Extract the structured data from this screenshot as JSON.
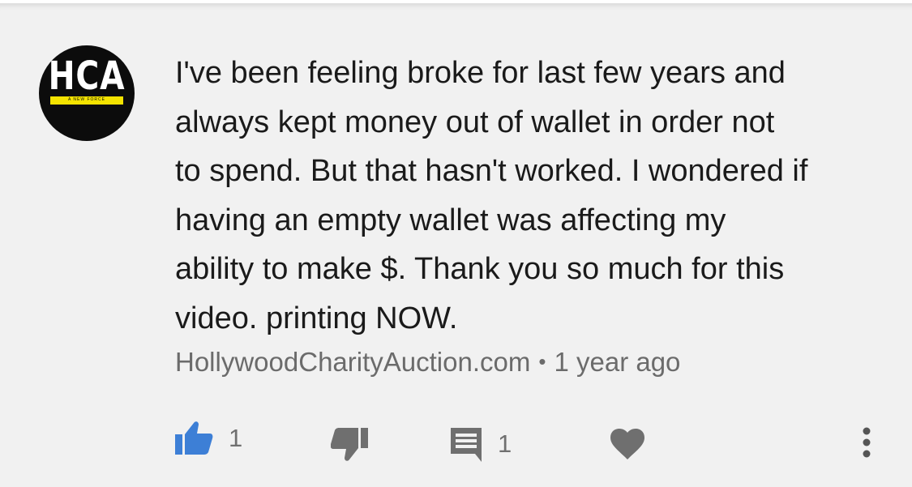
{
  "comment": {
    "author": "HollywoodCharityAuction.com",
    "time": "1 year ago",
    "text": "I've been feeling broke for last few years and\nalways kept money out of wallet in order not\nto spend. But that hasn't worked. I wondered if\nhaving an empty wallet was affecting my\nability to make $.  Thank you so much for this\nvideo. printing NOW.",
    "separator": "•"
  },
  "avatar": {
    "logo_text": "HCA",
    "band_text": "A NEW FORCE",
    "colors": {
      "background": "#0c0c0c",
      "band": "#f4e300",
      "text": "#ffffff"
    }
  },
  "actions": {
    "like": {
      "icon": "thumb-up-icon",
      "count": "1",
      "state": "active",
      "color": "#3d7fd6"
    },
    "dislike": {
      "icon": "thumb-down-icon"
    },
    "reply": {
      "icon": "comment-icon",
      "count": "1"
    },
    "heart": {
      "icon": "heart-icon"
    },
    "more": {
      "icon": "more-vert-icon"
    }
  },
  "colors": {
    "background": "#f1f1f1",
    "text": "#1a1a1a",
    "meta": "#6b6b6b",
    "icon": "#6f6f6f"
  }
}
